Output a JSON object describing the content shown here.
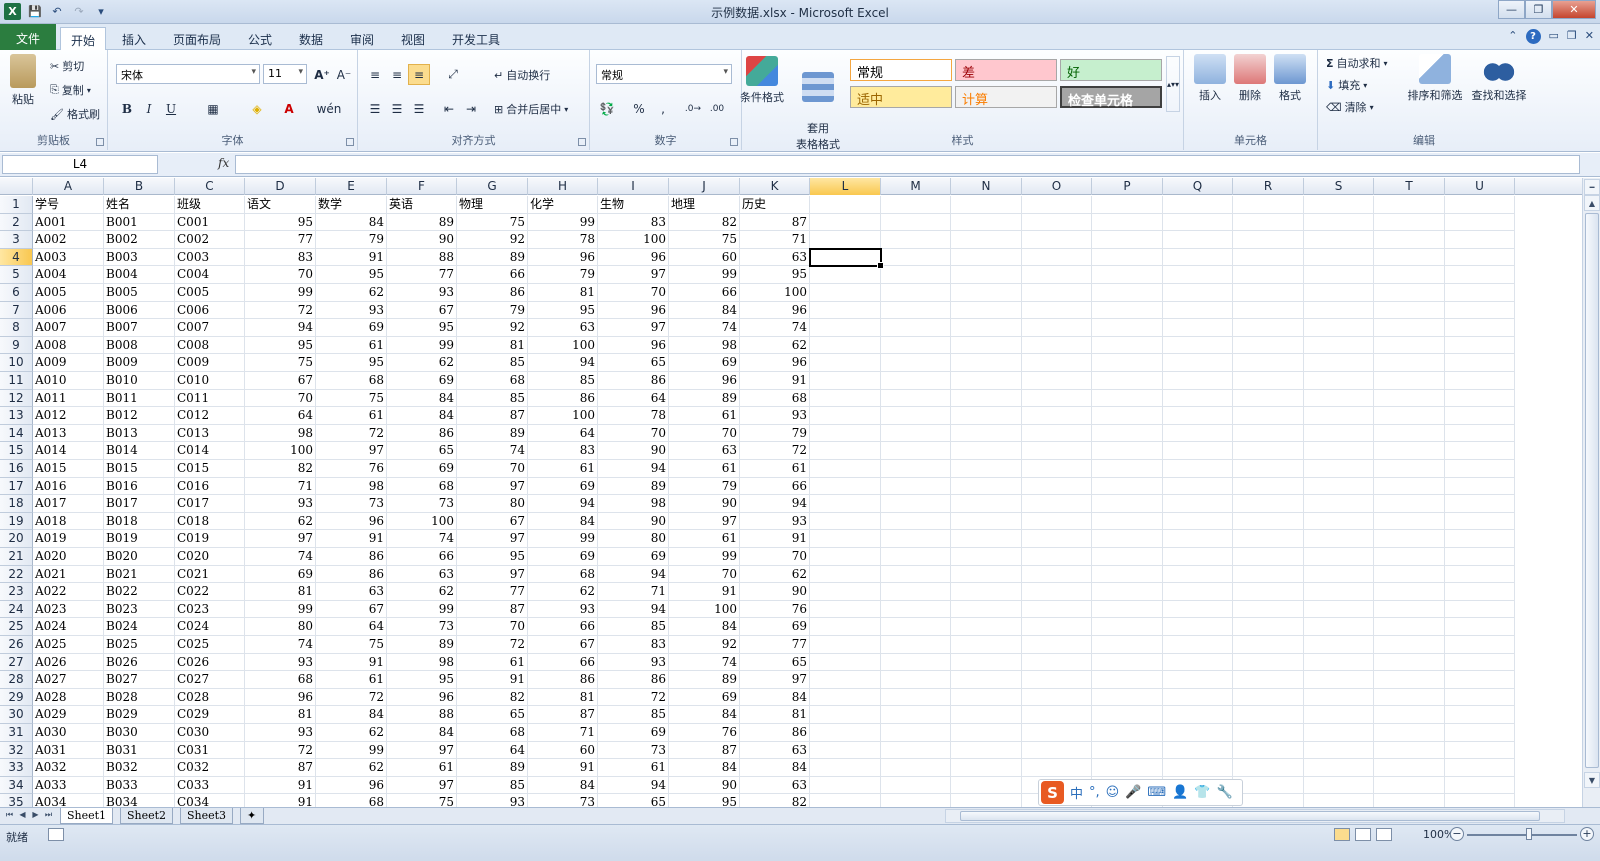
{
  "window": {
    "title": "示例数据.xlsx  -  Microsoft Excel"
  },
  "ribbon_tabs": [
    "文件",
    "开始",
    "插入",
    "页面布局",
    "公式",
    "数据",
    "审阅",
    "视图",
    "开发工具"
  ],
  "clipboard": {
    "paste": "粘贴",
    "cut": "剪切",
    "copy": "复制",
    "format_painter": "格式刷",
    "label": "剪贴板"
  },
  "font": {
    "name": "宋体",
    "size": "11",
    "bold": "B",
    "italic": "I",
    "underline": "U",
    "label": "字体"
  },
  "alignment": {
    "wrap": "自动换行",
    "merge": "合并后居中",
    "label": "对齐方式"
  },
  "number": {
    "format": "常规",
    "percent": "%",
    "comma": ",",
    "label": "数字"
  },
  "styles": {
    "conditional": "条件格式",
    "table_format": "套用\n表格格式",
    "cells": [
      {
        "label": "常规",
        "bg": "#ffffff",
        "color": "#000000",
        "border": "#f4a641"
      },
      {
        "label": "差",
        "bg": "#ffc7ce",
        "color": "#9c0006"
      },
      {
        "label": "好",
        "bg": "#c6efce",
        "color": "#006100"
      },
      {
        "label": "适中",
        "bg": "#ffeb9c",
        "color": "#9c6500"
      },
      {
        "label": "计算",
        "bg": "#f2f2f2",
        "color": "#fa7d00"
      },
      {
        "label": "检查单元格",
        "bg": "#a5a5a5",
        "color": "#ffffff"
      }
    ],
    "label": "样式"
  },
  "cells_group": {
    "insert": "插入",
    "delete": "删除",
    "format": "格式",
    "label": "单元格"
  },
  "editing": {
    "autosum": "自动求和",
    "fill": "填充",
    "clear": "清除",
    "sort": "排序和筛选",
    "find": "查找和选择",
    "label": "编辑"
  },
  "formula_bar": {
    "name_box": "L4",
    "fx": "fx",
    "content": ""
  },
  "columns": [
    "A",
    "B",
    "C",
    "D",
    "E",
    "F",
    "G",
    "H",
    "I",
    "J",
    "K",
    "L",
    "M",
    "N",
    "O",
    "P",
    "Q",
    "R",
    "S",
    "T",
    "U"
  ],
  "selected_column": "L",
  "selected_row": 4,
  "headers": [
    "学号",
    "姓名",
    "班级",
    "语文",
    "数学",
    "英语",
    "物理",
    "化学",
    "生物",
    "地理",
    "历史"
  ],
  "rows": [
    [
      "A001",
      "B001",
      "C001",
      95,
      84,
      89,
      75,
      99,
      83,
      82,
      87
    ],
    [
      "A002",
      "B002",
      "C002",
      77,
      79,
      90,
      92,
      78,
      100,
      75,
      71
    ],
    [
      "A003",
      "B003",
      "C003",
      83,
      91,
      88,
      89,
      96,
      96,
      60,
      63
    ],
    [
      "A004",
      "B004",
      "C004",
      70,
      95,
      77,
      66,
      79,
      97,
      99,
      95
    ],
    [
      "A005",
      "B005",
      "C005",
      99,
      62,
      93,
      86,
      81,
      70,
      66,
      100
    ],
    [
      "A006",
      "B006",
      "C006",
      72,
      93,
      67,
      79,
      95,
      96,
      84,
      96
    ],
    [
      "A007",
      "B007",
      "C007",
      94,
      69,
      95,
      92,
      63,
      97,
      74,
      74
    ],
    [
      "A008",
      "B008",
      "C008",
      95,
      61,
      99,
      81,
      100,
      96,
      98,
      62
    ],
    [
      "A009",
      "B009",
      "C009",
      75,
      95,
      62,
      85,
      94,
      65,
      69,
      96
    ],
    [
      "A010",
      "B010",
      "C010",
      67,
      68,
      69,
      68,
      85,
      86,
      96,
      91
    ],
    [
      "A011",
      "B011",
      "C011",
      70,
      75,
      84,
      85,
      86,
      64,
      89,
      68
    ],
    [
      "A012",
      "B012",
      "C012",
      64,
      61,
      84,
      87,
      100,
      78,
      61,
      93
    ],
    [
      "A013",
      "B013",
      "C013",
      98,
      72,
      86,
      89,
      64,
      70,
      70,
      79
    ],
    [
      "A014",
      "B014",
      "C014",
      100,
      97,
      65,
      74,
      83,
      90,
      63,
      72
    ],
    [
      "A015",
      "B015",
      "C015",
      82,
      76,
      69,
      70,
      61,
      94,
      61,
      61
    ],
    [
      "A016",
      "B016",
      "C016",
      71,
      98,
      68,
      97,
      69,
      89,
      79,
      66
    ],
    [
      "A017",
      "B017",
      "C017",
      93,
      73,
      73,
      80,
      94,
      98,
      90,
      94
    ],
    [
      "A018",
      "B018",
      "C018",
      62,
      96,
      100,
      67,
      84,
      90,
      97,
      93
    ],
    [
      "A019",
      "B019",
      "C019",
      97,
      91,
      74,
      97,
      99,
      80,
      61,
      91
    ],
    [
      "A020",
      "B020",
      "C020",
      74,
      86,
      66,
      95,
      69,
      69,
      99,
      70
    ],
    [
      "A021",
      "B021",
      "C021",
      69,
      86,
      63,
      97,
      68,
      94,
      70,
      62
    ],
    [
      "A022",
      "B022",
      "C022",
      81,
      63,
      62,
      77,
      62,
      71,
      91,
      90
    ],
    [
      "A023",
      "B023",
      "C023",
      99,
      67,
      99,
      87,
      93,
      94,
      100,
      76
    ],
    [
      "A024",
      "B024",
      "C024",
      80,
      64,
      73,
      70,
      66,
      85,
      84,
      69
    ],
    [
      "A025",
      "B025",
      "C025",
      74,
      75,
      89,
      72,
      67,
      83,
      92,
      77
    ],
    [
      "A026",
      "B026",
      "C026",
      93,
      91,
      98,
      61,
      66,
      93,
      74,
      65
    ],
    [
      "A027",
      "B027",
      "C027",
      68,
      61,
      95,
      91,
      86,
      86,
      89,
      97
    ],
    [
      "A028",
      "B028",
      "C028",
      96,
      72,
      96,
      82,
      81,
      72,
      69,
      84
    ],
    [
      "A029",
      "B029",
      "C029",
      81,
      84,
      88,
      65,
      87,
      85,
      84,
      81
    ],
    [
      "A030",
      "B030",
      "C030",
      93,
      62,
      84,
      68,
      71,
      69,
      76,
      86
    ],
    [
      "A031",
      "B031",
      "C031",
      72,
      99,
      97,
      64,
      60,
      73,
      87,
      63
    ],
    [
      "A032",
      "B032",
      "C032",
      87,
      62,
      61,
      89,
      91,
      61,
      84,
      84
    ],
    [
      "A033",
      "B033",
      "C033",
      91,
      96,
      97,
      85,
      84,
      94,
      90,
      63
    ],
    [
      "A034",
      "B034",
      "C034",
      91,
      68,
      75,
      93,
      73,
      65,
      95,
      82
    ]
  ],
  "sheets": [
    "Sheet1",
    "Sheet2",
    "Sheet3"
  ],
  "active_sheet": "Sheet1",
  "status": {
    "ready": "就绪",
    "zoom": "100%"
  },
  "ime": {
    "lang": "中",
    "punct": "°,",
    "logo": "S"
  }
}
